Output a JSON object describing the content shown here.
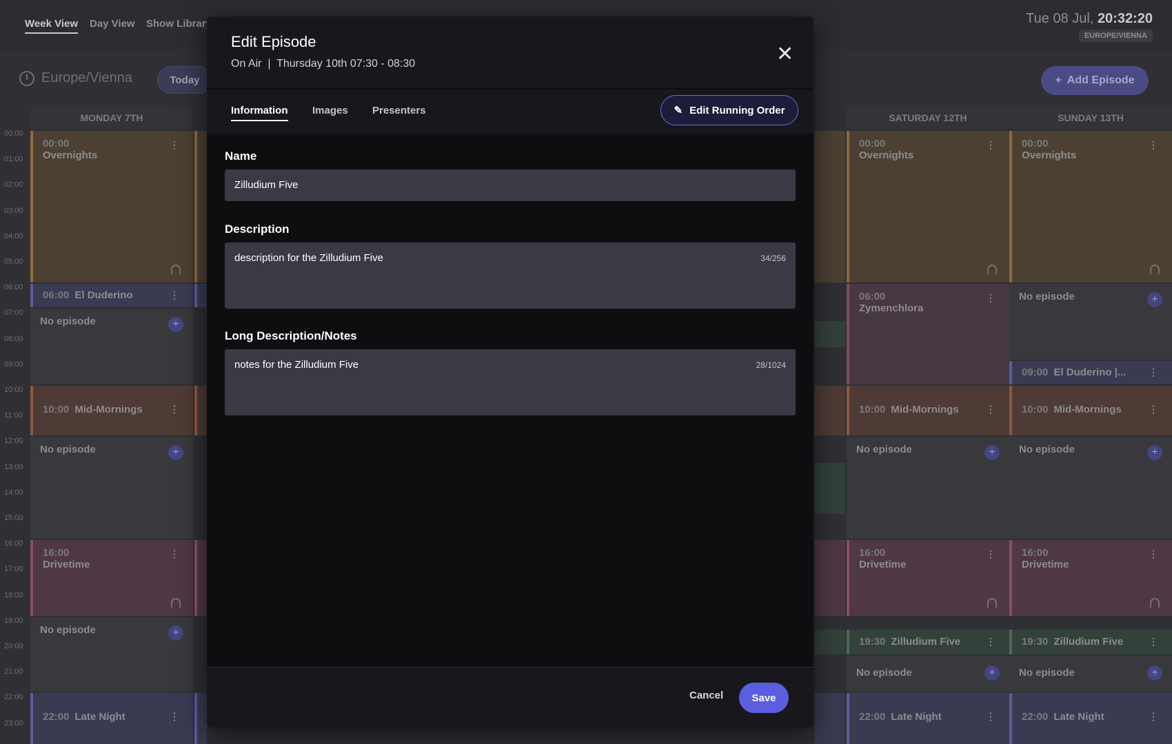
{
  "header": {
    "tabs": [
      "Week View",
      "Day View",
      "Show Library"
    ],
    "clock_date": "Tue 08 Jul,",
    "clock_time": "20:32:20",
    "timezone_badge": "EUROPE/VIENNA"
  },
  "toolbar": {
    "timezone": "Europe/Vienna",
    "today": "Today",
    "add_episode": "Add Episode"
  },
  "calendar": {
    "days": [
      "MONDAY 7TH",
      "SATURDAY 12TH",
      "SUNDAY 13TH"
    ],
    "times": [
      "00:00",
      "01:00",
      "02:00",
      "03:00",
      "04:00",
      "05:00",
      "06:00",
      "07:00",
      "08:00",
      "09:00",
      "10:00",
      "11:00",
      "12:00",
      "13:00",
      "14:00",
      "15:00",
      "16:00",
      "17:00",
      "18:00",
      "19:00",
      "20:00",
      "21:00",
      "22:00",
      "23:00"
    ],
    "monday": {
      "overnights_time": "00:00",
      "overnights": "Overnights",
      "duderino_time": "06:00",
      "duderino": "El Duderino",
      "no_episode": "No episode",
      "midmornings_time": "10:00",
      "midmornings": "Mid-Mornings",
      "drivetime_time": "16:00",
      "drivetime": "Drivetime",
      "latenight_time": "22:00",
      "latenight": "Late Night"
    },
    "saturday": {
      "overnights_time": "00:00",
      "overnights": "Overnights",
      "zymen_time": "06:00",
      "zymen": "Zymenchlora",
      "midmornings_time": "10:00",
      "midmornings": "Mid-Mornings",
      "no_episode": "No episode",
      "drivetime_time": "16:00",
      "drivetime": "Drivetime",
      "zill_time": "19:30",
      "zill": "Zilludium Five",
      "latenight_time": "22:00",
      "latenight": "Late Night"
    },
    "sunday": {
      "overnights_time": "00:00",
      "overnights": "Overnights",
      "no_episode": "No episode",
      "duderino_time": "09:00",
      "duderino": "El Duderino |...",
      "midmornings_time": "10:00",
      "midmornings": "Mid-Mornings",
      "drivetime_time": "16:00",
      "drivetime": "Drivetime",
      "zill_time": "19:30",
      "zill": "Zilludium Five",
      "latenight_time": "22:00",
      "latenight": "Late Night"
    }
  },
  "modal": {
    "title": "Edit Episode",
    "subtitle": "On Air  |  Thursday 10th 07:30 - 08:30",
    "tabs": [
      "Information",
      "Images",
      "Presenters"
    ],
    "edit_running_order": "Edit Running Order",
    "name_label": "Name",
    "name_value": "Zilludium Five",
    "description_label": "Description",
    "description_value": "description for the Zilludium Five",
    "description_count": "34/256",
    "notes_label": "Long Description/Notes",
    "notes_value": "notes for the Zilludium Five",
    "notes_count": "28/1024",
    "cancel": "Cancel",
    "save": "Save"
  },
  "colors": {
    "accent": "#5b5ee0",
    "modal_bg": "#0e0e11",
    "field_bg": "#3a3a44"
  }
}
